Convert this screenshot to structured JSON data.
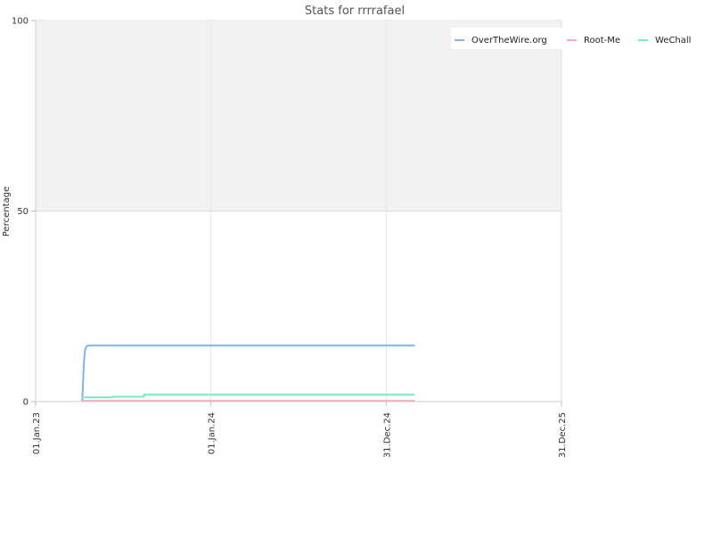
{
  "chart_data": {
    "type": "line",
    "title": "Stats for rrrrafael",
    "ylabel": "Percentage",
    "xlabel": "",
    "ylim": [
      0,
      100
    ],
    "y_ticks": [
      "0",
      "50",
      "100"
    ],
    "x_range": [
      "2023-01-01",
      "2025-12-31"
    ],
    "x_ticks": [
      {
        "date": "2023-01-01",
        "label": "01.Jan.23"
      },
      {
        "date": "2024-01-01",
        "label": "01.Jan.24"
      },
      {
        "date": "2024-12-31",
        "label": "31.Dec.24"
      },
      {
        "date": "2025-12-31",
        "label": "31.Dec.25"
      }
    ],
    "shaded_band": {
      "from": 50,
      "to": 100,
      "color": "#f2f2f2"
    },
    "grid": true,
    "legend_position": "top-right",
    "series": [
      {
        "name": "OverTheWire.org",
        "color": "#7cb5ec",
        "points": [
          {
            "x": "2023-04-08",
            "y": 0
          },
          {
            "x": "2023-04-09",
            "y": 3
          },
          {
            "x": "2023-04-10",
            "y": 6
          },
          {
            "x": "2023-04-11",
            "y": 9
          },
          {
            "x": "2023-04-12",
            "y": 11
          },
          {
            "x": "2023-04-13",
            "y": 12.5
          },
          {
            "x": "2023-04-14",
            "y": 13.5
          },
          {
            "x": "2023-04-15",
            "y": 14
          },
          {
            "x": "2023-04-17",
            "y": 14.5
          },
          {
            "x": "2023-04-20",
            "y": 14.7
          },
          {
            "x": "2025-02-28",
            "y": 14.7
          }
        ]
      },
      {
        "name": "Root-Me",
        "color": "#f7a9b8",
        "points": [
          {
            "x": "2023-04-08",
            "y": 0.2
          },
          {
            "x": "2025-02-28",
            "y": 0.2
          }
        ]
      },
      {
        "name": "WeChall",
        "color": "#7ee8c0",
        "points": [
          {
            "x": "2023-04-08",
            "y": 1.1
          },
          {
            "x": "2023-06-10",
            "y": 1.1
          },
          {
            "x": "2023-06-10",
            "y": 1.3
          },
          {
            "x": "2023-08-15",
            "y": 1.3
          },
          {
            "x": "2023-08-15",
            "y": 1.8
          },
          {
            "x": "2025-02-28",
            "y": 1.8
          }
        ]
      }
    ]
  }
}
